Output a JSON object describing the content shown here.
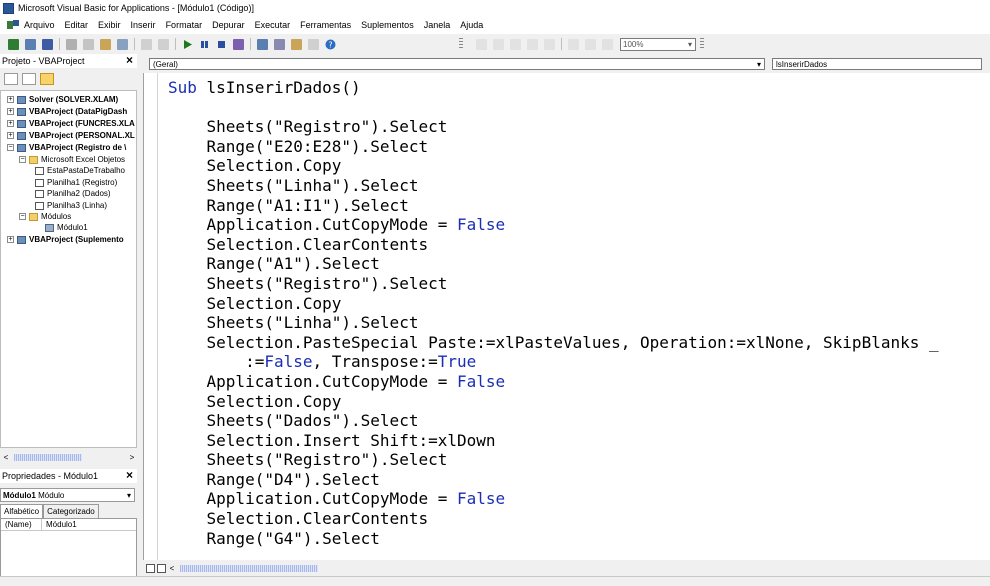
{
  "window": {
    "title": "Microsoft Visual Basic for Applications - [Módulo1 (Código)]"
  },
  "menu": [
    "Arquivo",
    "Editar",
    "Exibir",
    "Inserir",
    "Formatar",
    "Depurar",
    "Executar",
    "Ferramentas",
    "Suplementos",
    "Janela",
    "Ajuda"
  ],
  "toolbar": {
    "zoom": "100%"
  },
  "project_panel": {
    "title": "Projeto - VBAProject",
    "close": "×",
    "items": [
      {
        "label": "Solver (SOLVER.XLAM)"
      },
      {
        "label": "VBAProject (DataPigDash"
      },
      {
        "label": "VBAProject (FUNCRES.XLA"
      },
      {
        "label": "VBAProject (PERSONAL.XL"
      },
      {
        "label": "VBAProject (Registro de \\"
      },
      {
        "label": "Microsoft Excel Objetos"
      },
      {
        "label": "EstaPastaDeTrabalho"
      },
      {
        "label": "Planilha1 (Registro)"
      },
      {
        "label": "Planilha2 (Dados)"
      },
      {
        "label": "Planilha3 (Linha)"
      },
      {
        "label": "Módulos"
      },
      {
        "label": "Módulo1"
      },
      {
        "label": "VBAProject (Suplemento"
      }
    ]
  },
  "properties_panel": {
    "title": "Propriedades - Módulo1",
    "close": "×",
    "object_name": "Módulo1",
    "object_type": "Módulo",
    "tabs": [
      "Alfabético",
      "Categorizado"
    ],
    "rows": [
      {
        "name": "(Name)",
        "value": "Módulo1"
      }
    ]
  },
  "code_window": {
    "object_combo": "(Geral)",
    "procedure_combo": "lsInserirDados",
    "code_lines": [
      "Sub lsInserirDados()",
      "",
      "    Sheets(\"Registro\").Select",
      "    Range(\"E20:E28\").Select",
      "    Selection.Copy",
      "    Sheets(\"Linha\").Select",
      "    Range(\"A1:I1\").Select",
      "    Application.CutCopyMode = False",
      "    Selection.ClearContents",
      "    Range(\"A1\").Select",
      "    Sheets(\"Registro\").Select",
      "    Selection.Copy",
      "    Sheets(\"Linha\").Select",
      "    Selection.PasteSpecial Paste:=xlPasteValues, Operation:=xlNone, SkipBlanks _",
      "        :=False, Transpose:=True",
      "    Application.CutCopyMode = False",
      "    Selection.Copy",
      "    Sheets(\"Dados\").Select",
      "    Selection.Insert Shift:=xlDown",
      "    Sheets(\"Registro\").Select",
      "    Range(\"D4\").Select",
      "    Application.CutCopyMode = False",
      "    Selection.ClearContents",
      "    Range(\"G4\").Select"
    ]
  }
}
